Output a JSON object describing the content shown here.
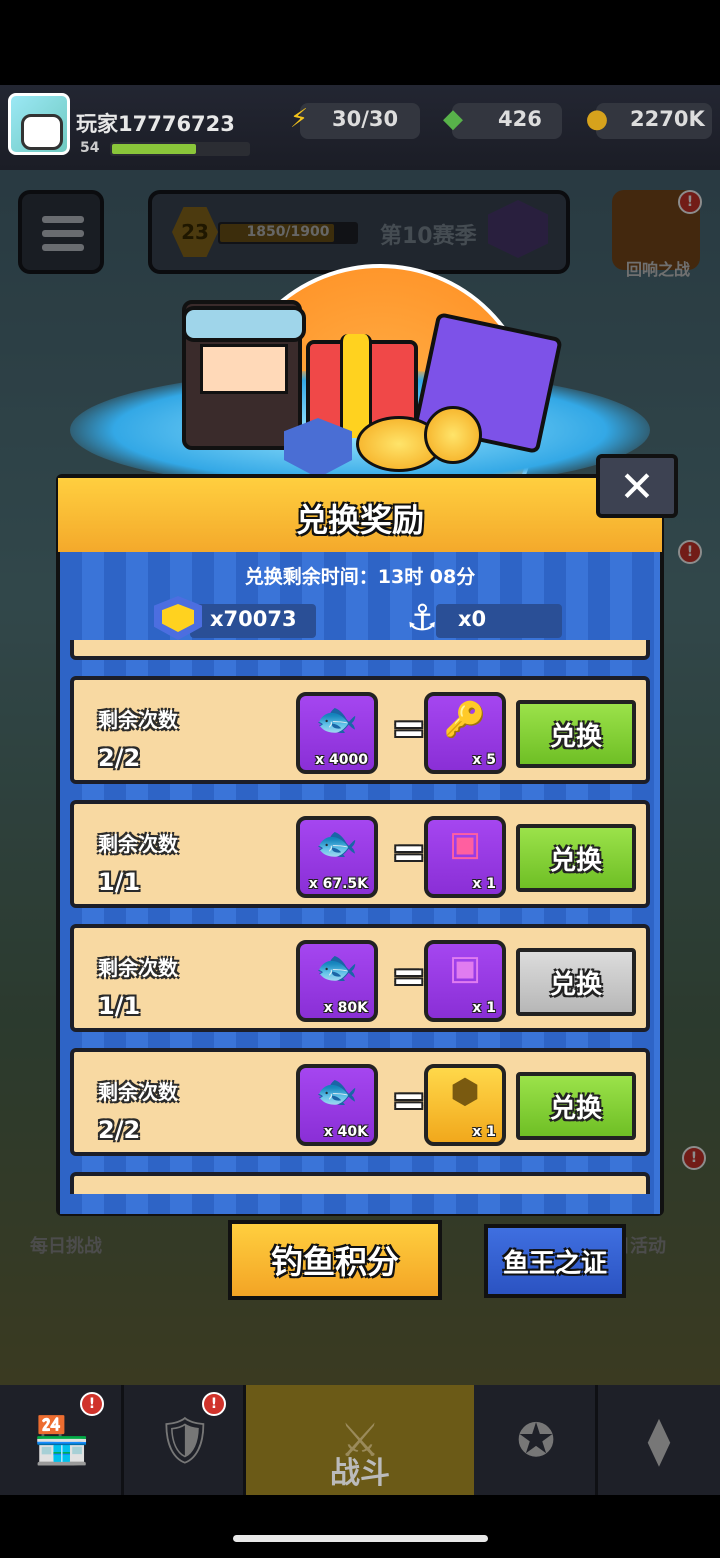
{
  "player": {
    "name": "玩家17776723",
    "level": "54",
    "xp_progress": 0.6
  },
  "resources": {
    "energy": "30/30",
    "gems": "426",
    "coins": "2270K"
  },
  "season": {
    "rank": "23",
    "progress_text": "1850/1900",
    "progress": 0.97,
    "label": "第10赛季"
  },
  "side": {
    "echo_battle": "回响之战",
    "echo_badge": "!",
    "daily_challenge": "每日挑战",
    "daily_activity": "日活动"
  },
  "modal": {
    "title": "兑换奖励",
    "close_label": "✕",
    "timer": "兑换剩余时间：13时 08分",
    "fish_token_count": "x70073",
    "hook_count": "x0"
  },
  "rows": [
    {
      "label": "剩余次数",
      "count": "2/2",
      "cost_qty": "x 4000",
      "reward_icon": "key-icon",
      "reward_qty": "x 5",
      "button": "兑换",
      "enabled": true
    },
    {
      "label": "剩余次数",
      "count": "1/1",
      "cost_qty": "x 67.5K",
      "reward_icon": "s-chest-pink-icon",
      "reward_qty": "x 1",
      "button": "兑换",
      "enabled": true
    },
    {
      "label": "剩余次数",
      "count": "1/1",
      "cost_qty": "x 80K",
      "reward_icon": "s-chest-purple-icon",
      "reward_qty": "x 1",
      "button": "兑换",
      "enabled": false
    },
    {
      "label": "剩余次数",
      "count": "2/2",
      "cost_qty": "x 40K",
      "reward_icon": "gold-chest-icon",
      "reward_qty": "x 1",
      "button": "兑换",
      "enabled": true
    }
  ],
  "tabs": {
    "fishing_points": "钓鱼积分",
    "fish_king_proof": "鱼王之证"
  },
  "bottom_nav": {
    "fight": "战斗"
  },
  "colors": {
    "accent_yellow": "#f4a92b",
    "modal_blue": "#2e64c6",
    "row_bg": "#f8d9a2",
    "button_green": "#7dcc2d",
    "button_gray": "#c4c4c4",
    "slot_purple": "#9a3de6"
  }
}
